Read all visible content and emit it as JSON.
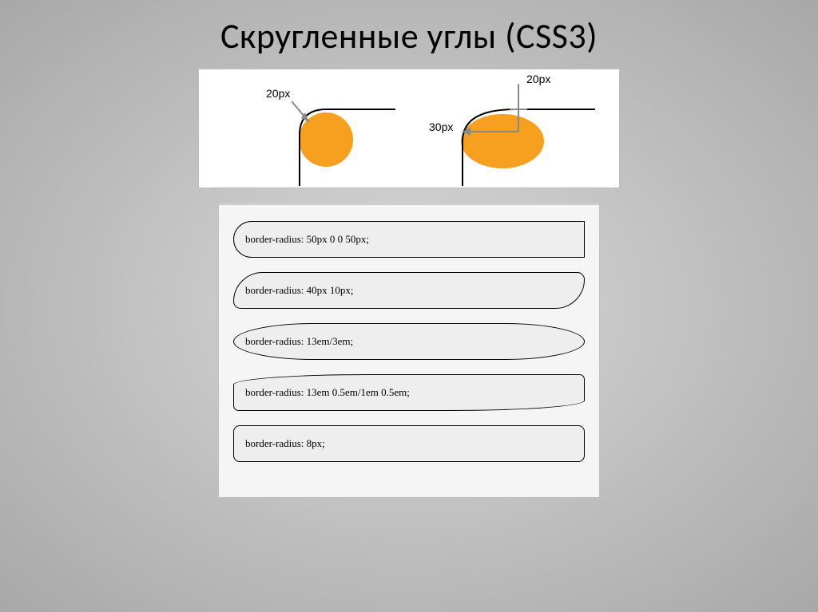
{
  "slide": {
    "title": "Скругленные углы (CSS3)"
  },
  "diagram": {
    "label_left": "20px",
    "label_right_top": "20px",
    "label_right_mid": "30px"
  },
  "examples": [
    {
      "text": "border-radius: 50px 0 0 50px;",
      "style": "border-radius: 50px 0 0 50px;"
    },
    {
      "text": "border-radius: 40px 10px;",
      "style": "border-radius: 40px 10px;"
    },
    {
      "text": "border-radius: 13em/3em;",
      "style": "border-radius: 13em/3em;"
    },
    {
      "text": "border-radius: 13em 0.5em/1em 0.5em;",
      "style": "border-radius: 13em 0.5em/1em 0.5em;"
    },
    {
      "text": "border-radius: 8px;",
      "style": "border-radius: 8px;"
    }
  ]
}
